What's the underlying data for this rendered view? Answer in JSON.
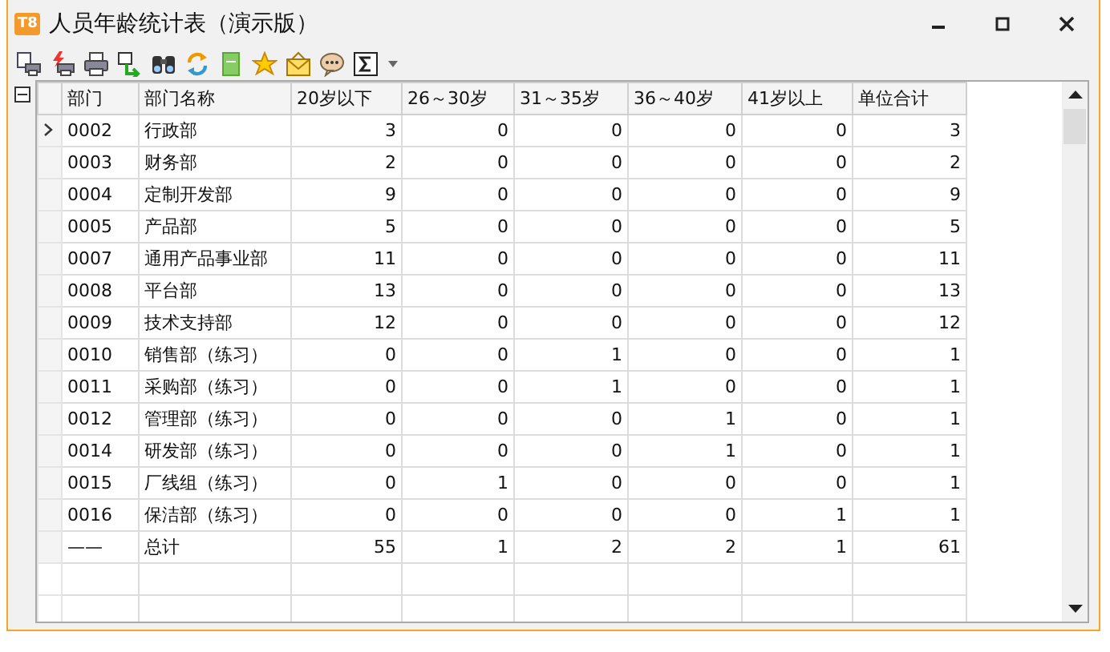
{
  "window": {
    "title": "人员年龄统计表（演示版）",
    "logo": "T8"
  },
  "table": {
    "columns": [
      "部门",
      "部门名称",
      "20岁以下",
      "26～30岁",
      "31～35岁",
      "36～40岁",
      "41岁以上",
      "单位合计"
    ],
    "rows": [
      {
        "cells": [
          "0002",
          "行政部",
          "3",
          "0",
          "0",
          "0",
          "0",
          "3"
        ],
        "selected": true
      },
      {
        "cells": [
          "0003",
          "财务部",
          "2",
          "0",
          "0",
          "0",
          "0",
          "2"
        ],
        "selected": false
      },
      {
        "cells": [
          "0004",
          "定制开发部",
          "9",
          "0",
          "0",
          "0",
          "0",
          "9"
        ],
        "selected": false
      },
      {
        "cells": [
          "0005",
          "产品部",
          "5",
          "0",
          "0",
          "0",
          "0",
          "5"
        ],
        "selected": false
      },
      {
        "cells": [
          "0007",
          "通用产品事业部",
          "11",
          "0",
          "0",
          "0",
          "0",
          "11"
        ],
        "selected": false
      },
      {
        "cells": [
          "0008",
          "平台部",
          "13",
          "0",
          "0",
          "0",
          "0",
          "13"
        ],
        "selected": false
      },
      {
        "cells": [
          "0009",
          "技术支持部",
          "12",
          "0",
          "0",
          "0",
          "0",
          "12"
        ],
        "selected": false
      },
      {
        "cells": [
          "0010",
          "销售部（练习）",
          "0",
          "0",
          "1",
          "0",
          "0",
          "1"
        ],
        "selected": false
      },
      {
        "cells": [
          "0011",
          "采购部（练习）",
          "0",
          "0",
          "1",
          "0",
          "0",
          "1"
        ],
        "selected": false
      },
      {
        "cells": [
          "0012",
          "管理部（练习）",
          "0",
          "0",
          "0",
          "1",
          "0",
          "1"
        ],
        "selected": false
      },
      {
        "cells": [
          "0014",
          "研发部（练习）",
          "0",
          "0",
          "0",
          "1",
          "0",
          "1"
        ],
        "selected": false
      },
      {
        "cells": [
          "0015",
          "厂线组（练习）",
          "0",
          "1",
          "0",
          "0",
          "0",
          "1"
        ],
        "selected": false
      },
      {
        "cells": [
          "0016",
          "保洁部（练习）",
          "0",
          "0",
          "0",
          "0",
          "1",
          "1"
        ],
        "selected": false
      },
      {
        "cells": [
          "——",
          "总计",
          "55",
          "1",
          "2",
          "2",
          "1",
          "61"
        ],
        "selected": false
      }
    ]
  }
}
